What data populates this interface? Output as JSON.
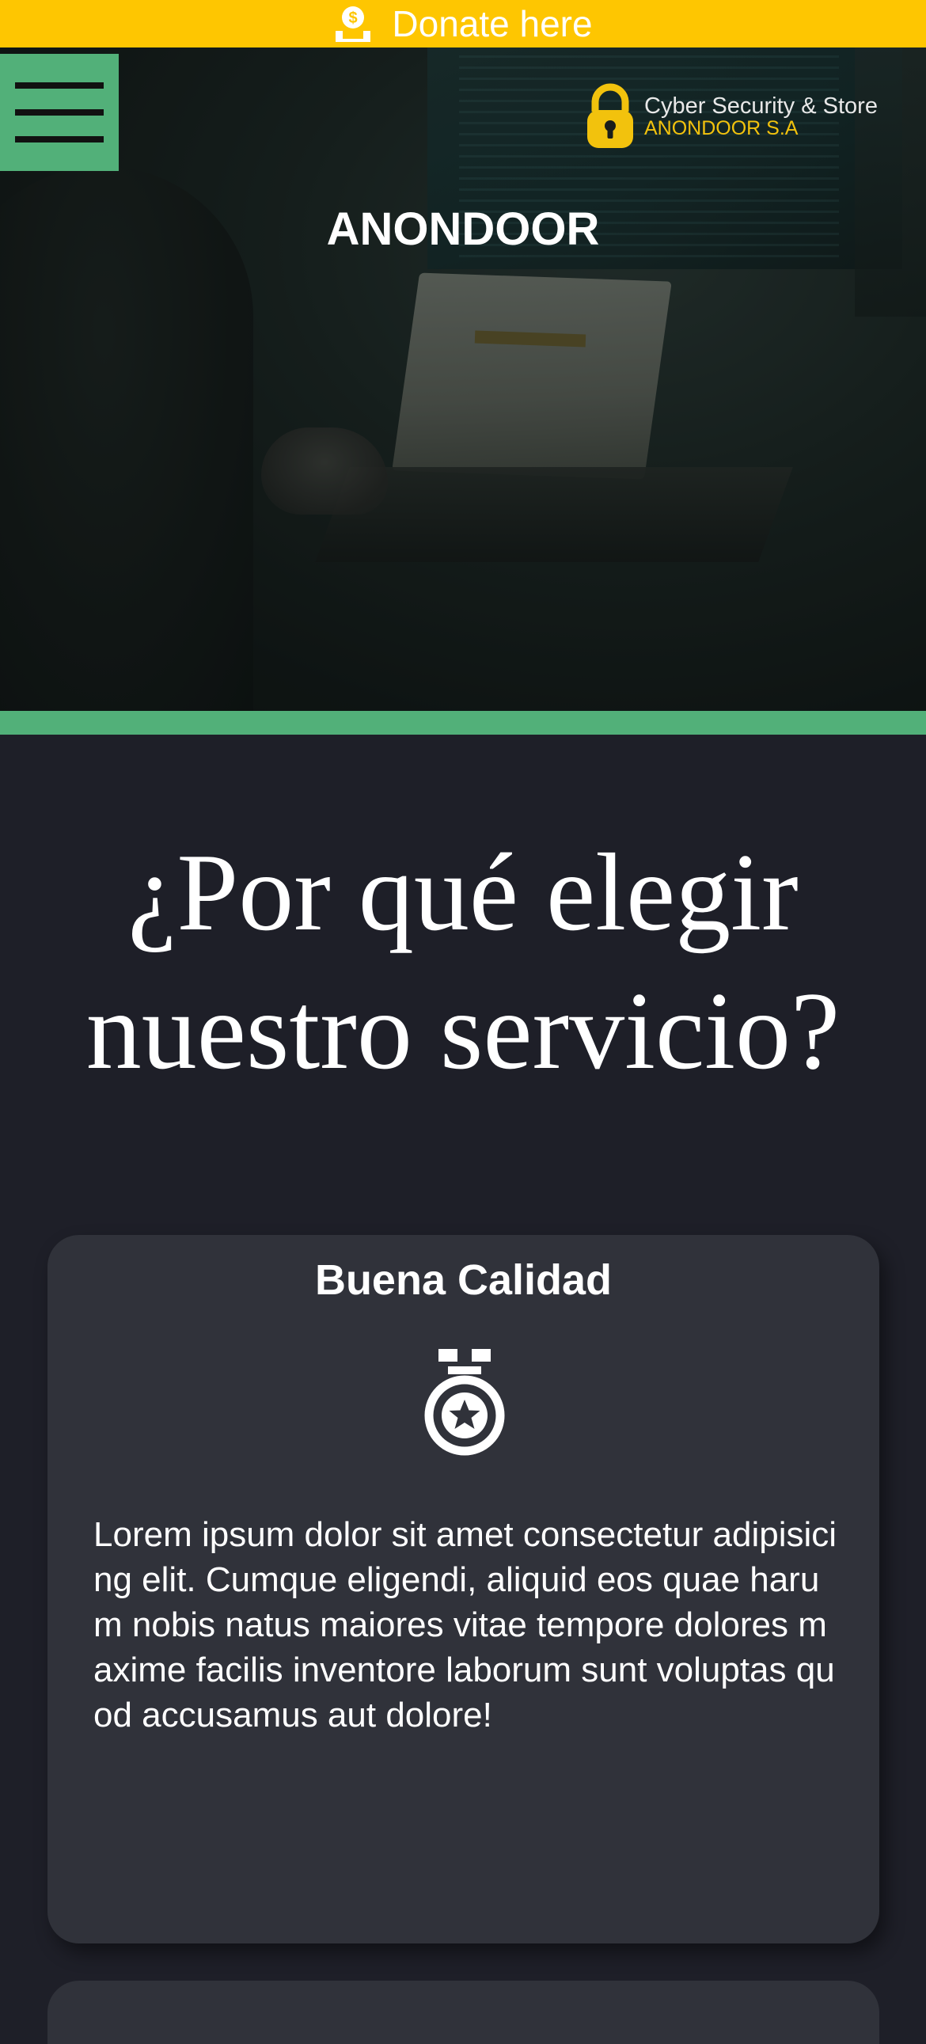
{
  "donate": {
    "label": "Donate here",
    "icon": "donate-hand-coin-icon"
  },
  "header": {
    "menu_icon": "hamburger-menu-icon",
    "logo": {
      "line1": "Cyber Security & Store",
      "line2": "ANONDOOR S.A",
      "icon": "padlock-icon"
    },
    "title": "ANONDOOR"
  },
  "section": {
    "heading_line1": "¿Por qué elegir",
    "heading_line2": "nuestro servicio?"
  },
  "cards": [
    {
      "title": "Buena Calidad",
      "icon": "medal-star-icon",
      "body": "Lorem ipsum dolor sit amet consectetur adipisicing elit. Cumque eligendi, aliquid eos quae harum nobis natus maiores vitae tempore dolores maxime facilis inventore laborum sunt voluptas quod accusamus aut dolore!"
    }
  ],
  "colors": {
    "donate_bar": "#fec601",
    "accent_green": "#52b079",
    "page_background": "#1e1f28",
    "card_background": "#30323a",
    "logo_gold": "#f2c20d"
  }
}
